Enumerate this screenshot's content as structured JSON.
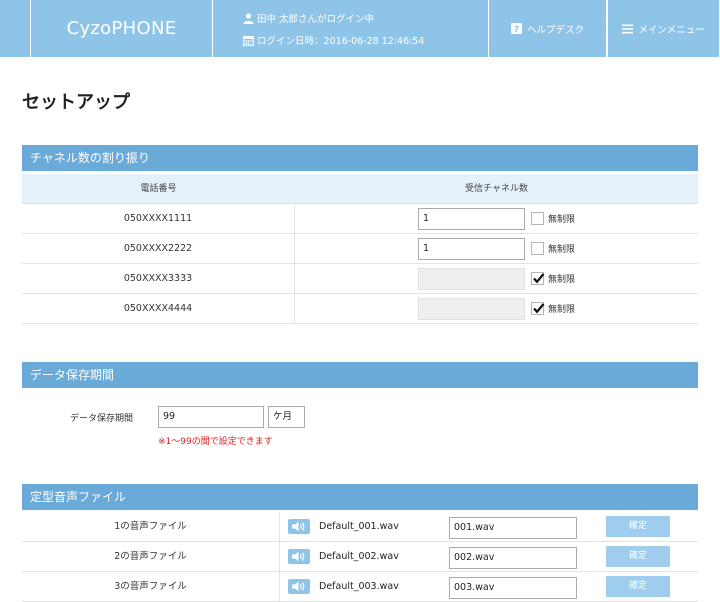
{
  "header": {
    "logo": "CyzoPHONE",
    "user_text": "田中 太郎さんがログイン中",
    "login_time": "ログイン日時：2016-06-28 12:46:54",
    "help_label": "ヘルプデスク",
    "menu_label": "メインメニュー"
  },
  "page": {
    "title": "セットアップ"
  },
  "channels": {
    "section_title": "チャネル数の割り振り",
    "col_phone": "電話番号",
    "col_channels": "受信チャネル数",
    "unlimited_label": "無制限",
    "rows": [
      {
        "phone": "050XXXX1111",
        "value": "1",
        "unlimited": false
      },
      {
        "phone": "050XXXX2222",
        "value": "1",
        "unlimited": false
      },
      {
        "phone": "050XXXX3333",
        "value": "",
        "unlimited": true
      },
      {
        "phone": "050XXXX4444",
        "value": "",
        "unlimited": true
      }
    ]
  },
  "retention": {
    "section_title": "データ保存期間",
    "label": "データ保存期間",
    "value": "99",
    "unit": "ケ月",
    "note": "※1～99の間で設定できます"
  },
  "audio": {
    "section_title": "定型音声ファイル",
    "confirm_label": "確定",
    "rows": [
      {
        "label": "1の音声ファイル",
        "default_file": "Default_001.wav",
        "file": "001.wav"
      },
      {
        "label": "2の音声ファイル",
        "default_file": "Default_002.wav",
        "file": "002.wav"
      },
      {
        "label": "3の音声ファイル",
        "default_file": "Default_003.wav",
        "file": "003.wav"
      }
    ]
  },
  "icons": {
    "user": "user-icon",
    "calendar": "calendar-icon",
    "help": "question-icon",
    "menu": "hamburger-menu-icon",
    "speaker": "speaker-icon",
    "check": "checkmark-icon"
  }
}
